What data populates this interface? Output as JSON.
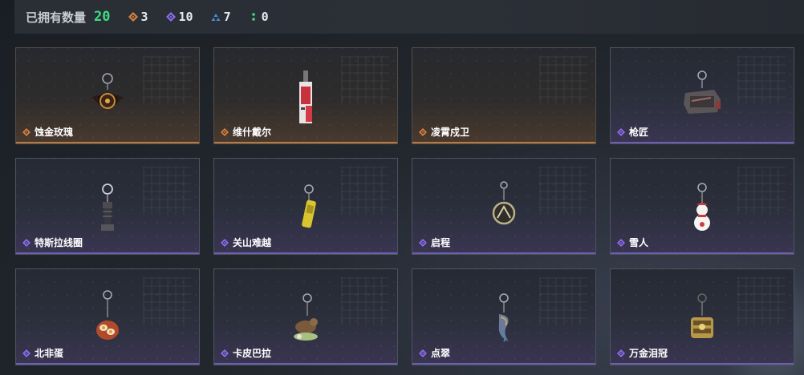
{
  "header": {
    "title": "已拥有数量",
    "total": "20",
    "stats": [
      {
        "icon": "gold-diamond-icon",
        "color": "#d9813f",
        "count": "3"
      },
      {
        "icon": "purple-diamond-icon",
        "color": "#8c6cf0",
        "count": "10"
      },
      {
        "icon": "blue-triangle-icon",
        "color": "#4a8fd8",
        "count": "7"
      },
      {
        "icon": "green-dot-icon",
        "color": "#3ddc84",
        "count": "0"
      }
    ]
  },
  "items": [
    {
      "name": "蚀金玫瑰",
      "rarity": "gold",
      "icon": "rose-charm-icon"
    },
    {
      "name": "维什戴尔",
      "rarity": "gold",
      "icon": "red-card-charm-icon"
    },
    {
      "name": "凌霄戍卫",
      "rarity": "gold",
      "icon": "empty-slot-icon"
    },
    {
      "name": "枪匠",
      "rarity": "purple",
      "icon": "gun-case-charm-icon"
    },
    {
      "name": "特斯拉线圈",
      "rarity": "purple",
      "icon": "tesla-coil-charm-icon"
    },
    {
      "name": "关山难越",
      "rarity": "purple",
      "icon": "yellow-can-charm-icon"
    },
    {
      "name": "启程",
      "rarity": "purple",
      "icon": "medallion-charm-icon"
    },
    {
      "name": "雪人",
      "rarity": "purple",
      "icon": "snowman-charm-icon"
    },
    {
      "name": "北非蛋",
      "rarity": "purple",
      "icon": "shakshuka-charm-icon"
    },
    {
      "name": "卡皮巴拉",
      "rarity": "purple",
      "icon": "capybara-charm-icon"
    },
    {
      "name": "点翠",
      "rarity": "purple",
      "icon": "kingfisher-charm-icon"
    },
    {
      "name": "万金泪冠",
      "rarity": "purple",
      "icon": "golden-crown-charm-icon"
    }
  ]
}
